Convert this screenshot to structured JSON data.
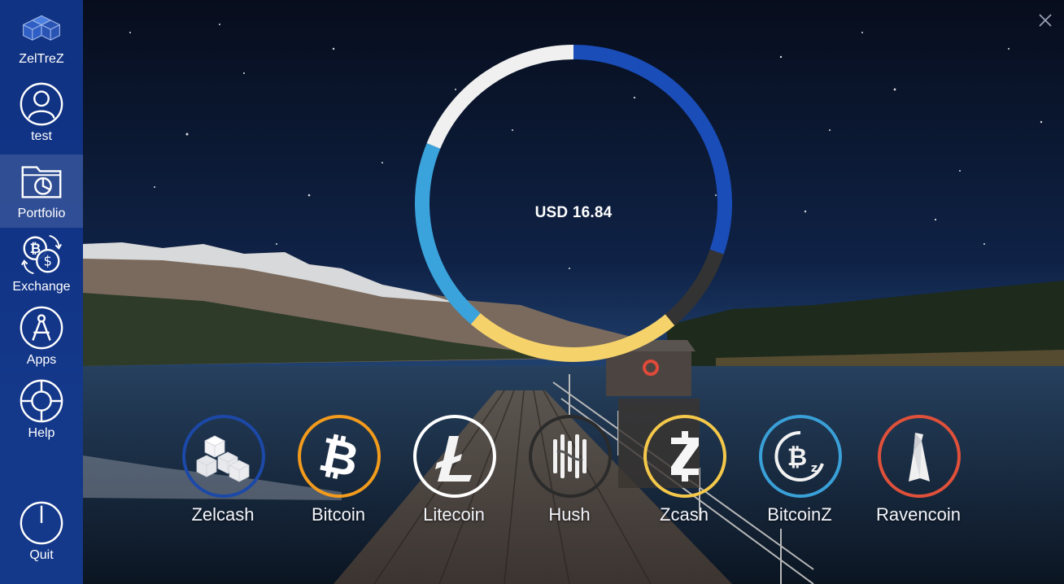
{
  "app": {
    "name": "ZelTreZ"
  },
  "sidebar": {
    "items": [
      {
        "label": "test",
        "icon": "user-icon"
      },
      {
        "label": "Portfolio",
        "icon": "portfolio-chart-icon",
        "active": true
      },
      {
        "label": "Exchange",
        "icon": "exchange-icon"
      },
      {
        "label": "Apps",
        "icon": "compass-icon"
      },
      {
        "label": "Help",
        "icon": "lifebuoy-icon"
      }
    ],
    "quit": {
      "label": "Quit",
      "icon": "power-icon"
    }
  },
  "portfolio": {
    "total_label": "USD 16.84",
    "ring_segments": [
      {
        "color": "#1a4db8",
        "share": 0.302
      },
      {
        "color": "#333333",
        "share": 0.088
      },
      {
        "color": "#f6d36a",
        "share": 0.222
      },
      {
        "color": "#3aa3dc",
        "share": 0.2
      },
      {
        "color": "#f0f0f0",
        "share": 0.188
      }
    ]
  },
  "coins": [
    {
      "name": "Zelcash",
      "ring_color": "#1c49a8",
      "icon": "zelcash-cubes-icon"
    },
    {
      "name": "Bitcoin",
      "ring_color": "#f29b1c",
      "icon": "bitcoin-icon"
    },
    {
      "name": "Litecoin",
      "ring_color": "#ffffff",
      "icon": "litecoin-icon"
    },
    {
      "name": "Hush",
      "ring_color": "#2b2b2b",
      "icon": "hush-icon"
    },
    {
      "name": "Zcash",
      "ring_color": "#f4c84a",
      "icon": "zcash-icon"
    },
    {
      "name": "BitcoinZ",
      "ring_color": "#3aa0d8",
      "icon": "bitcoinz-icon"
    },
    {
      "name": "Ravencoin",
      "ring_color": "#e0503a",
      "icon": "ravencoin-icon"
    }
  ]
}
